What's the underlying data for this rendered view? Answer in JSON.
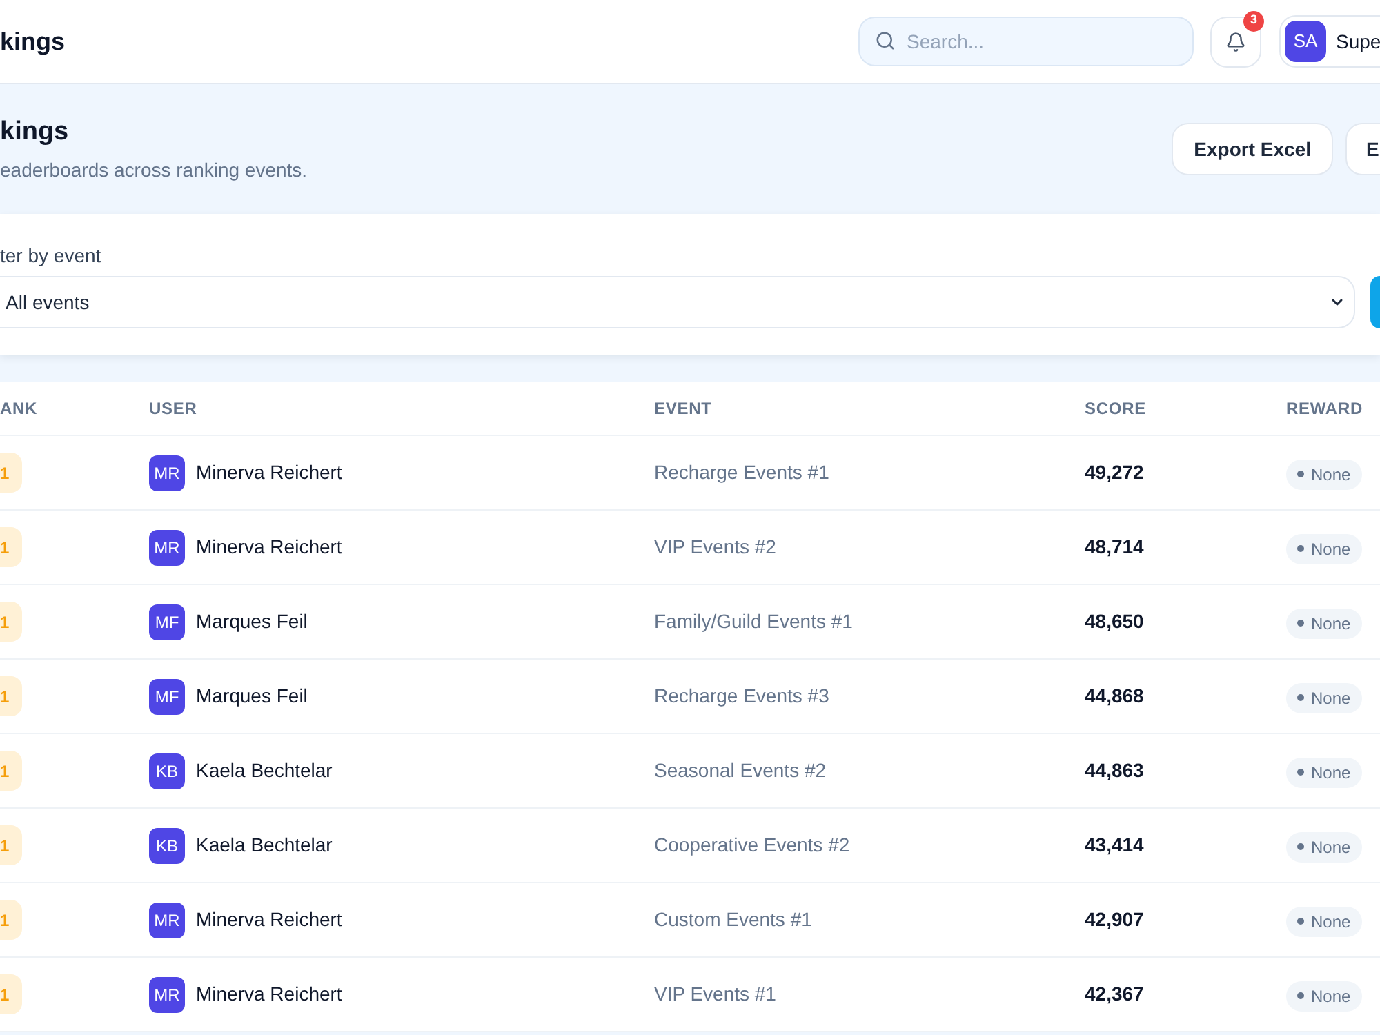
{
  "header": {
    "title": "kings",
    "search": {
      "placeholder": "Search..."
    },
    "notifications": {
      "count": "3"
    },
    "user": {
      "initials": "SA",
      "name": "Supe"
    }
  },
  "page_header": {
    "title": "kings",
    "subtitle": "eaderboards across ranking events.",
    "buttons": [
      "Export Excel",
      "E"
    ]
  },
  "filter": {
    "label": "ter by event",
    "select": {
      "value": "All events"
    }
  },
  "table": {
    "columns": [
      "ANK",
      "USER",
      "EVENT",
      "SCORE",
      "REWARD"
    ],
    "rows": [
      {
        "rank": "1",
        "initials": "MR",
        "user": "Minerva Reichert",
        "event": "Recharge Events #1",
        "score": "49,272",
        "reward": "None"
      },
      {
        "rank": "1",
        "initials": "MR",
        "user": "Minerva Reichert",
        "event": "VIP Events #2",
        "score": "48,714",
        "reward": "None"
      },
      {
        "rank": "1",
        "initials": "MF",
        "user": "Marques Feil",
        "event": "Family/Guild Events #1",
        "score": "48,650",
        "reward": "None"
      },
      {
        "rank": "1",
        "initials": "MF",
        "user": "Marques Feil",
        "event": "Recharge Events #3",
        "score": "44,868",
        "reward": "None"
      },
      {
        "rank": "1",
        "initials": "KB",
        "user": "Kaela Bechtelar",
        "event": "Seasonal Events #2",
        "score": "44,863",
        "reward": "None"
      },
      {
        "rank": "1",
        "initials": "KB",
        "user": "Kaela Bechtelar",
        "event": "Cooperative Events #2",
        "score": "43,414",
        "reward": "None"
      },
      {
        "rank": "1",
        "initials": "MR",
        "user": "Minerva Reichert",
        "event": "Custom Events #1",
        "score": "42,907",
        "reward": "None"
      },
      {
        "rank": "1",
        "initials": "MR",
        "user": "Minerva Reichert",
        "event": "VIP Events #1",
        "score": "42,367",
        "reward": "None"
      }
    ]
  }
}
